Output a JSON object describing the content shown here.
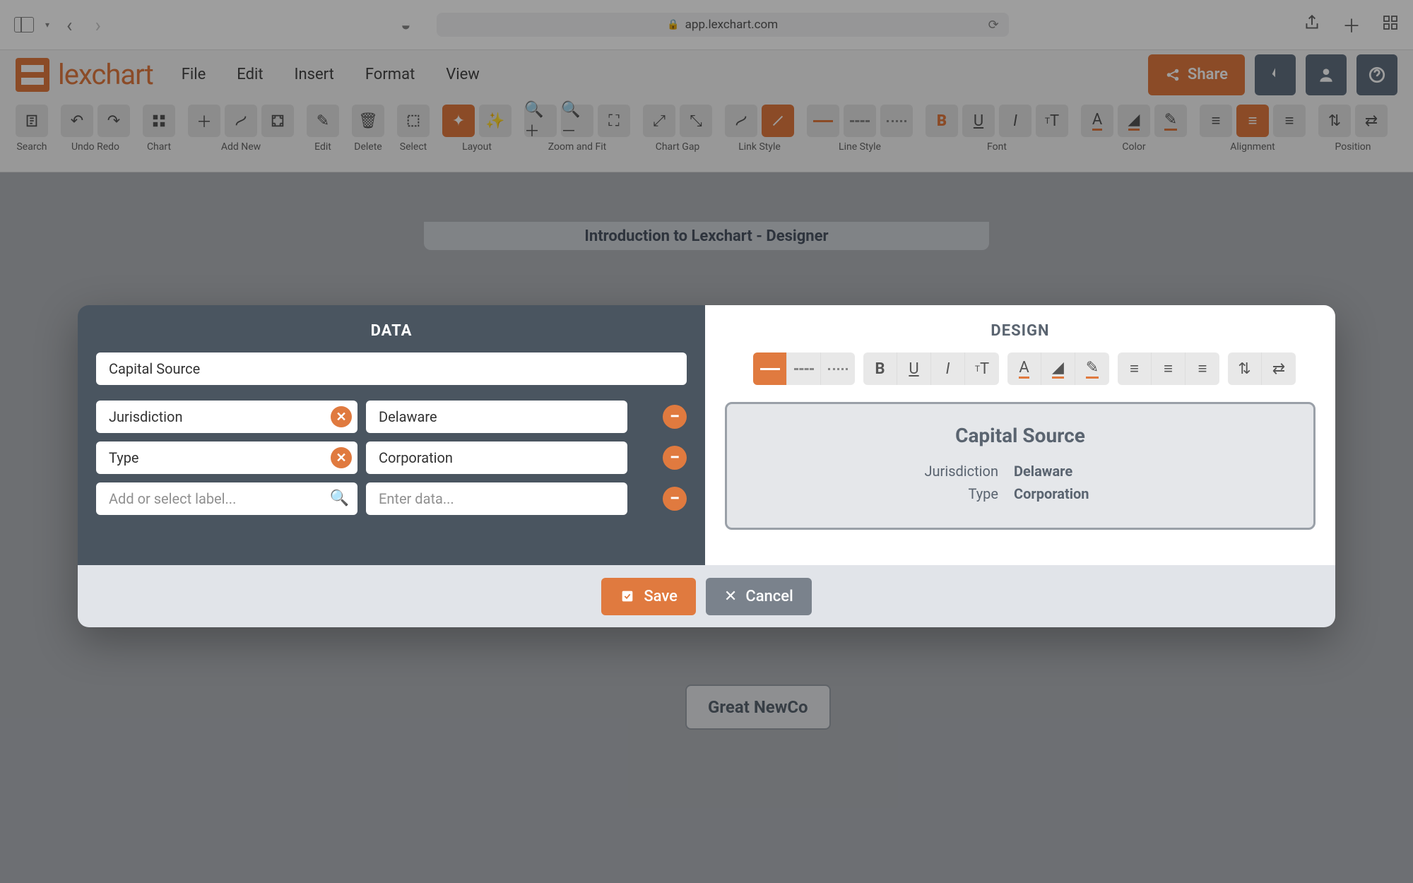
{
  "browser": {
    "url": "app.lexchart.com"
  },
  "app": {
    "brand": "lexchart",
    "menu": {
      "file": "File",
      "edit": "Edit",
      "insert": "Insert",
      "format": "Format",
      "view": "View"
    },
    "share": "Share"
  },
  "toolbar": {
    "search": "Search",
    "undoredo": "Undo Redo",
    "chart": "Chart",
    "addnew": "Add New",
    "edit": "Edit",
    "delete": "Delete",
    "select": "Select",
    "layout": "Layout",
    "zoomfit": "Zoom and Fit",
    "chartgap": "Chart Gap",
    "linkstyle": "Link Style",
    "linestyle": "Line Style",
    "font": "Font",
    "color": "Color",
    "alignment": "Alignment",
    "position": "Position"
  },
  "canvas": {
    "page_title": "Introduction to Lexchart - Designer",
    "node_greatnewco": "Great NewCo"
  },
  "modal": {
    "data_title": "DATA",
    "design_title": "DESIGN",
    "name": "Capital Source",
    "rows": [
      {
        "label": "Jurisdiction",
        "value": "Delaware"
      },
      {
        "label": "Type",
        "value": "Corporation"
      }
    ],
    "add_label_placeholder": "Add or select label...",
    "add_value_placeholder": "Enter data...",
    "preview": {
      "title": "Capital Source",
      "r1k": "Jurisdiction",
      "r1v": "Delaware",
      "r2k": "Type",
      "r2v": "Corporation"
    },
    "save": "Save",
    "cancel": "Cancel"
  }
}
